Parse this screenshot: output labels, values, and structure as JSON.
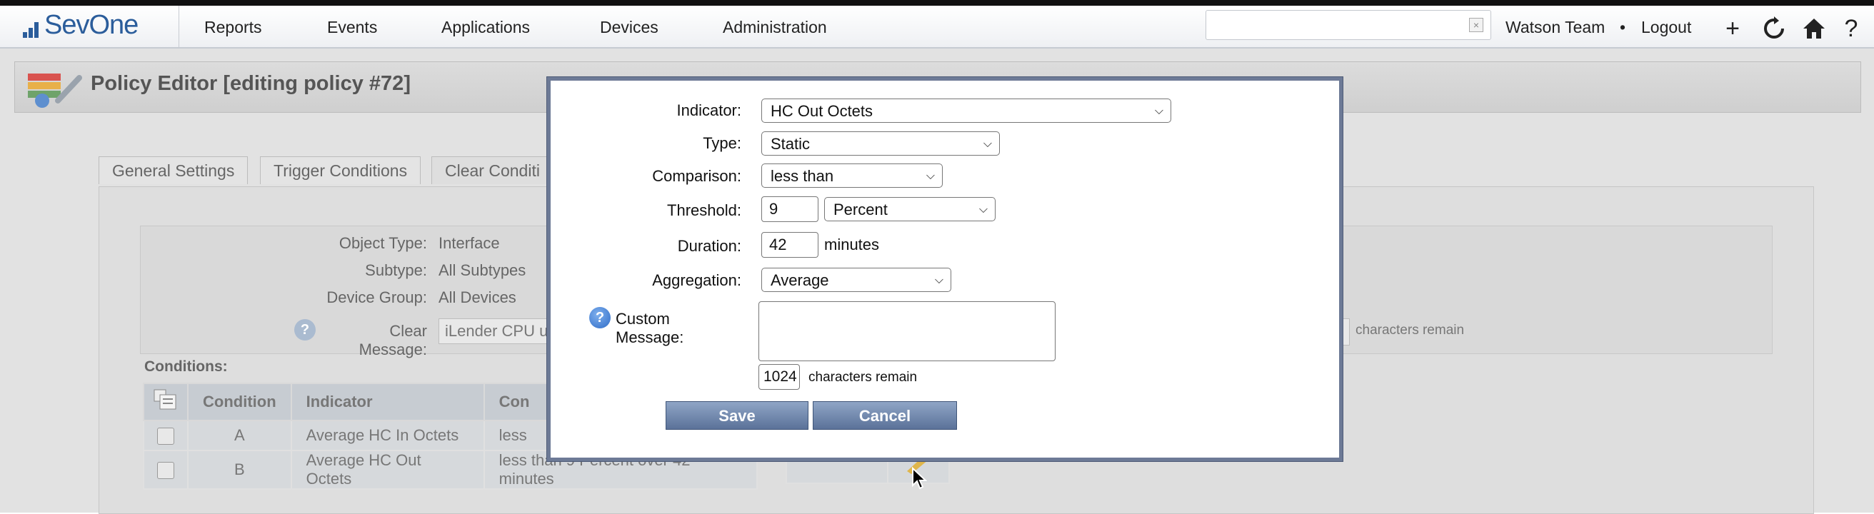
{
  "nav": {
    "logo": "SevOne",
    "items": [
      {
        "label": "Reports"
      },
      {
        "label": "Events"
      },
      {
        "label": "Applications"
      },
      {
        "label": "Devices"
      },
      {
        "label": "Administration"
      }
    ],
    "search_value": "",
    "user": "Watson Team",
    "separator": "•",
    "logout": "Logout",
    "icons": [
      "plus-icon",
      "refresh-icon",
      "home-icon",
      "help-icon"
    ]
  },
  "page": {
    "title": "Policy Editor [editing policy #72]",
    "tabs": [
      {
        "label": "General Settings"
      },
      {
        "label": "Trigger Conditions"
      },
      {
        "label": "Clear Conditi"
      }
    ],
    "info": {
      "object_type_label": "Object Type:",
      "object_type_value": "Interface",
      "subtype_label": "Subtype:",
      "subtype_value": "All Subtypes",
      "device_group_label": "Device Group:",
      "device_group_value": "All Devices",
      "clear_message_label": "Clear Message:",
      "clear_message_value": "iLender CPU u",
      "chars_remain": "characters remain"
    },
    "conditions_label": "Conditions:",
    "table": {
      "headers": [
        "Condition",
        "Indicator",
        "Con"
      ],
      "rows": [
        {
          "condition": "A",
          "indicator": "Average HC In Octets",
          "comparison": "less"
        },
        {
          "condition": "B",
          "indicator": "Average HC Out Octets",
          "comparison": "less than 9 Percent over 42 minutes"
        }
      ]
    }
  },
  "modal": {
    "indicator_label": "Indicator:",
    "indicator_value": "HC Out Octets",
    "type_label": "Type:",
    "type_value": "Static",
    "comparison_label": "Comparison:",
    "comparison_value": "less than",
    "threshold_label": "Threshold:",
    "threshold_value": "9",
    "threshold_unit": "Percent",
    "duration_label": "Duration:",
    "duration_value": "42",
    "duration_unit": "minutes",
    "aggregation_label": "Aggregation:",
    "aggregation_value": "Average",
    "custom_message_label": "Custom Message:",
    "custom_message_value": "",
    "chars_count": "1024",
    "chars_remain": "characters remain",
    "save": "Save",
    "cancel": "Cancel"
  },
  "colors": {
    "brand": "#2b5d9b",
    "modal_border": "#6d7a96",
    "button": "#6a82a8"
  }
}
